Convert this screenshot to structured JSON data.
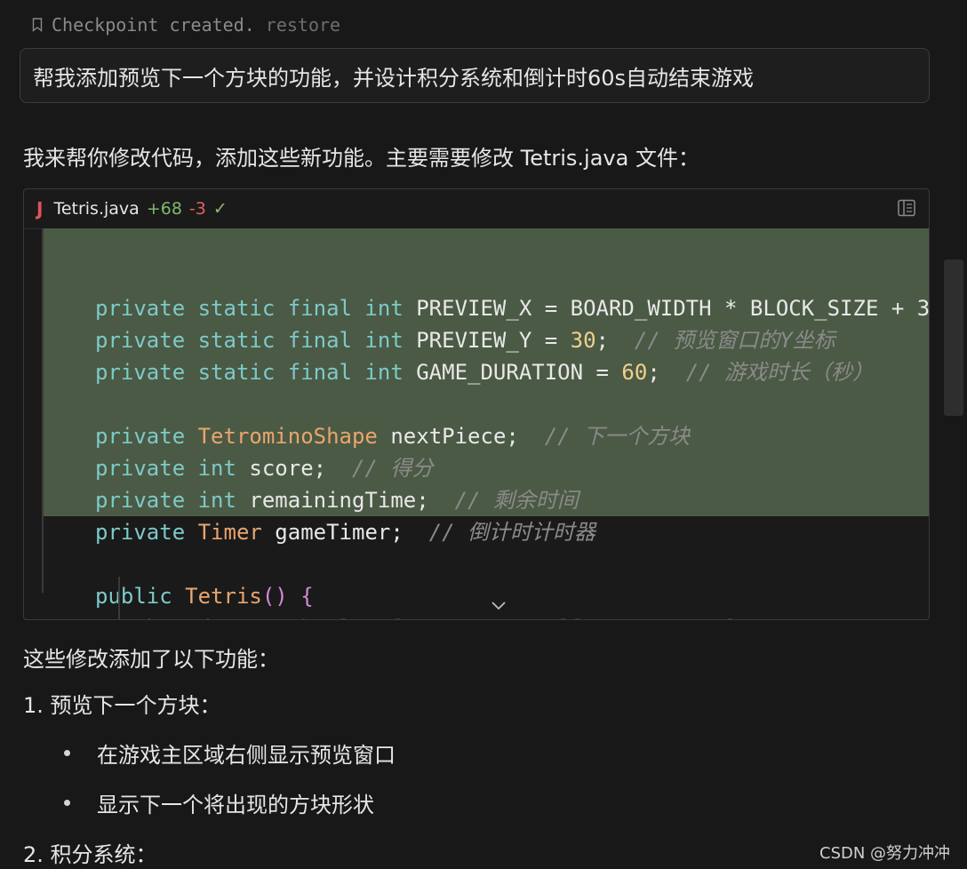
{
  "checkpoint": {
    "text": "Checkpoint created.",
    "restore_label": "restore"
  },
  "prompt": {
    "text": "帮我添加预览下一个方块的功能，并设计积分系统和倒计时60s自动结束游戏"
  },
  "response": {
    "intro": "我来帮你修改代码，添加这些新功能。主要需要修改 Tetris.java 文件："
  },
  "code_card": {
    "language_icon": "J",
    "filename": "Tetris.java",
    "added": "+68",
    "removed": "-3",
    "status_icon": "✓",
    "lines": [
      [],
      [
        {
          "c": "kw",
          "t": "private static final int "
        },
        {
          "c": "ident",
          "t": "PREVIEW_X = BOARD_WIDTH * BLOCK_SIZE + 3"
        }
      ],
      [
        {
          "c": "kw",
          "t": "private static final int "
        },
        {
          "c": "ident",
          "t": "PREVIEW_Y = "
        },
        {
          "c": "num",
          "t": "30"
        },
        {
          "c": "ident",
          "t": ";  "
        },
        {
          "c": "cmt",
          "t": "// 预览窗口的Y坐标"
        }
      ],
      [
        {
          "c": "kw",
          "t": "private static final int "
        },
        {
          "c": "ident",
          "t": "GAME_DURATION = "
        },
        {
          "c": "num",
          "t": "60"
        },
        {
          "c": "ident",
          "t": ";  "
        },
        {
          "c": "cmt",
          "t": "// 游戏时长（秒）"
        }
      ],
      [],
      [
        {
          "c": "kw",
          "t": "private "
        },
        {
          "c": "type",
          "t": "TetrominoShape "
        },
        {
          "c": "ident",
          "t": "nextPiece;  "
        },
        {
          "c": "cmt",
          "t": "// 下一个方块"
        }
      ],
      [
        {
          "c": "kw",
          "t": "private int "
        },
        {
          "c": "ident",
          "t": "score;  "
        },
        {
          "c": "cmt",
          "t": "// 得分"
        }
      ],
      [
        {
          "c": "kw",
          "t": "private int "
        },
        {
          "c": "ident",
          "t": "remainingTime;  "
        },
        {
          "c": "cmt",
          "t": "// 剩余时间"
        }
      ],
      [
        {
          "c": "kw",
          "t": "private "
        },
        {
          "c": "type",
          "t": "Timer "
        },
        {
          "c": "ident",
          "t": "gameTimer;  "
        },
        {
          "c": "cmt",
          "t": "// 倒计时计时器"
        }
      ],
      [],
      [
        {
          "c": "kw",
          "t": "public "
        },
        {
          "c": "fn",
          "t": "Tetris"
        },
        {
          "c": "paren",
          "t": "() {"
        }
      ],
      [
        {
          "c": "ident faded",
          "t": "    board = "
        },
        {
          "c": "kw faded",
          "t": "new boolean"
        },
        {
          "c": "bracket",
          "t": "["
        },
        {
          "c": "ident faded",
          "t": "BOARD_HEIGHT"
        },
        {
          "c": "bracket",
          "t": "]["
        },
        {
          "c": "ident faded",
          "t": "BOARD_WIDTH"
        },
        {
          "c": "bracket",
          "t": "]"
        },
        {
          "c": "ident faded",
          "t": ";"
        }
      ]
    ]
  },
  "summary": {
    "intro": "这些修改添加了以下功能：",
    "item1": "1. 预览下一个方块：",
    "item1_bullets": [
      "在游戏主区域右侧显示预览窗口",
      "显示下一个将出现的方块形状"
    ],
    "item2": "2. 积分系统："
  },
  "watermark": "CSDN @努力冲冲"
}
